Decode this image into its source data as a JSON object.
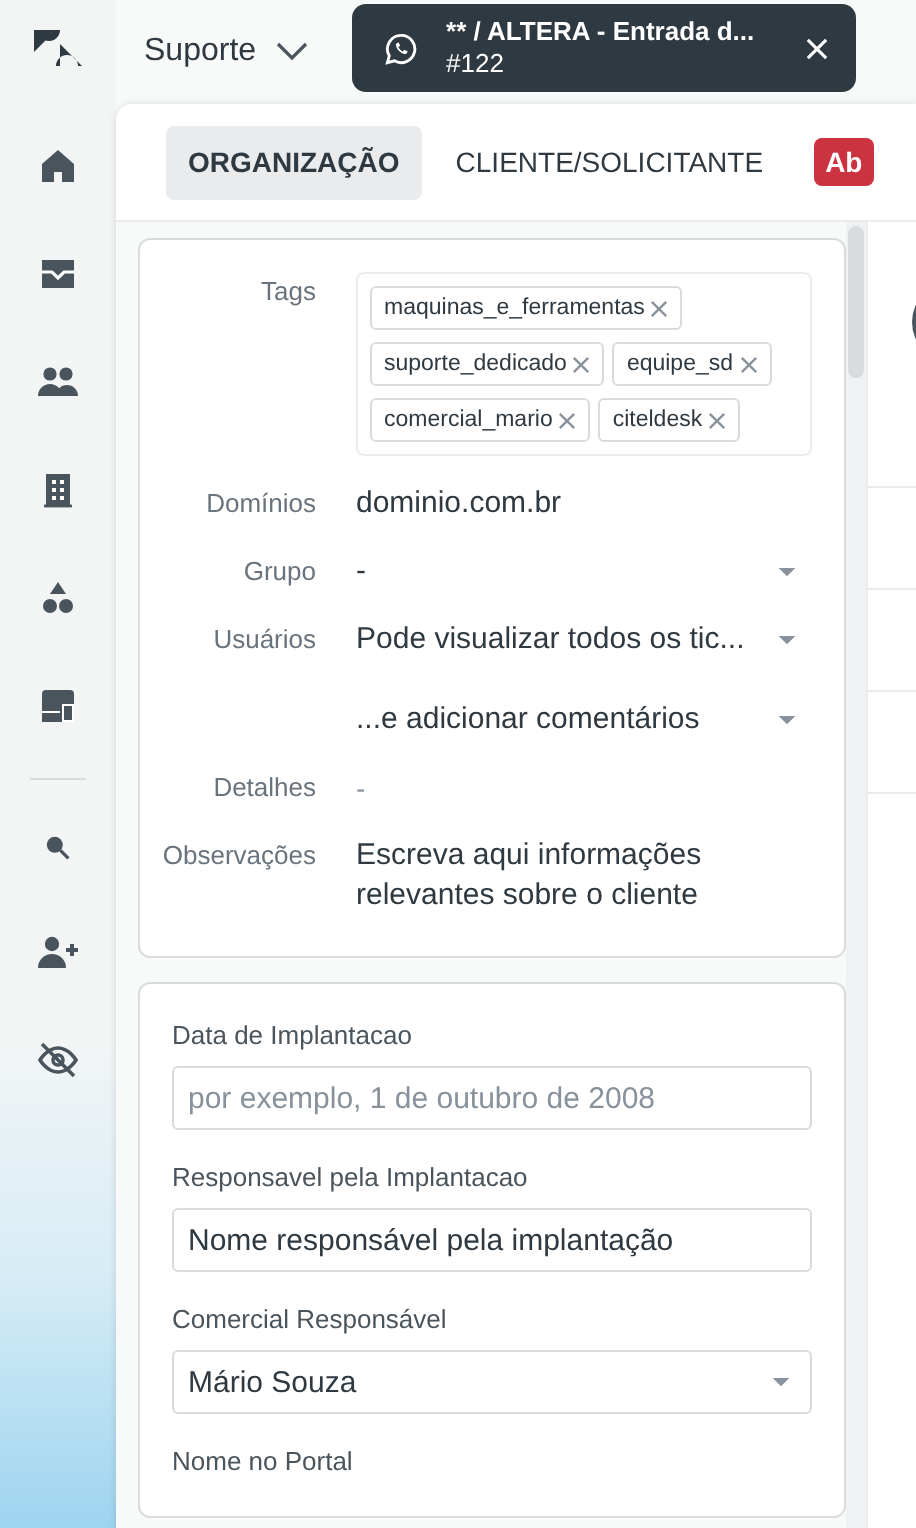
{
  "topbar": {
    "workspace": "Suporte",
    "ticket_tab": {
      "title": "** / ALTERA - Entrada d...",
      "number": "#122"
    }
  },
  "tabs": [
    {
      "label": "ORGANIZAÇÃO",
      "selected": true
    },
    {
      "label": "CLIENTE/SOLICITANTE",
      "selected": false
    }
  ],
  "status_badge": "Ab",
  "organization": {
    "fields": [
      {
        "label": "Tags",
        "kind": "tags",
        "tags": [
          "maquinas_e_ferramentas",
          "suporte_dedicado",
          "equipe_sd",
          "comercial_mario",
          "citeldesk"
        ]
      },
      {
        "label": "Domínios",
        "kind": "text",
        "value": "dominio.com.br"
      },
      {
        "label": "Grupo",
        "kind": "select",
        "values": [
          "-"
        ]
      },
      {
        "label": "Usuários",
        "kind": "select",
        "values": [
          "Pode visualizar todos os tic...",
          "...e adicionar comentários"
        ]
      },
      {
        "label": "Detalhes",
        "kind": "muted",
        "value": "-"
      },
      {
        "label": "Observações",
        "kind": "text",
        "value": "Escreva aqui informações relevantes sobre o cliente"
      }
    ]
  },
  "custom_fields": [
    {
      "label": "Data de Implantacao",
      "kind": "input",
      "placeholder": "por exemplo, 1 de outubro de 2008"
    },
    {
      "label": "Responsavel pela Implantacao",
      "kind": "input",
      "value": "Nome responsável pela implantação"
    },
    {
      "label": "Comercial Responsável",
      "kind": "select",
      "value": "Mário Souza"
    },
    {
      "label": "Nome no Portal",
      "kind": "label"
    }
  ]
}
